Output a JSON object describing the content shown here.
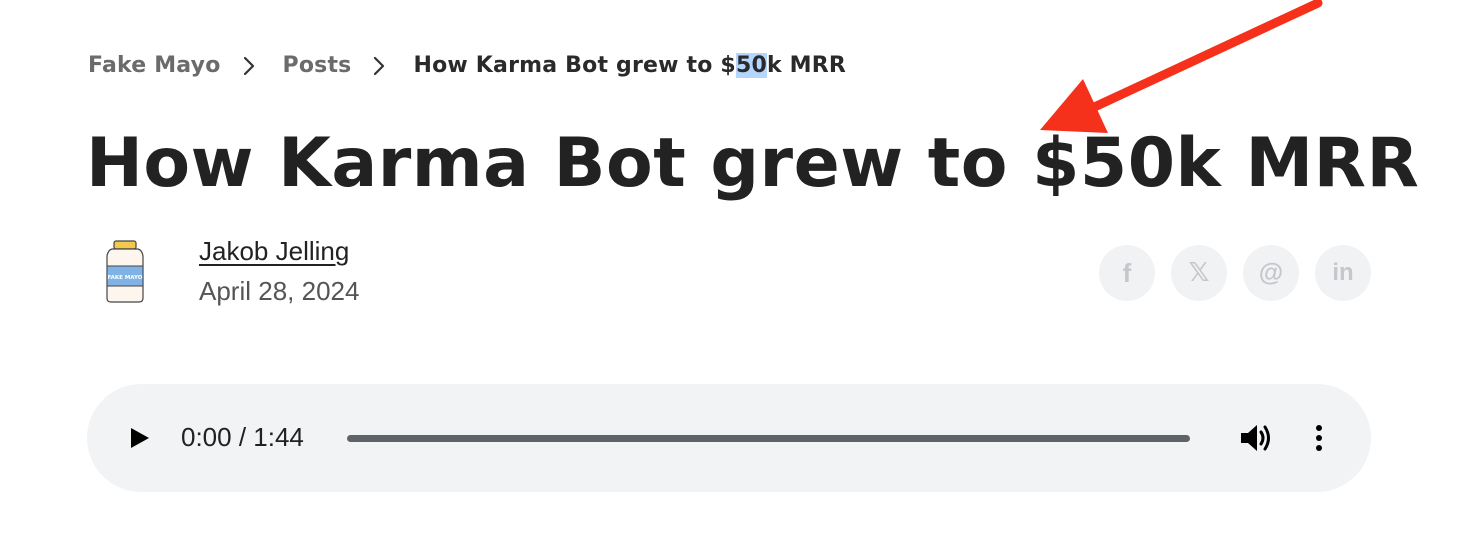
{
  "breadcrumb": {
    "items": [
      "Fake Mayo",
      "Posts"
    ],
    "current_prefix": "How Karma Bot grew to $",
    "current_highlight": "50",
    "current_suffix": "k MRR"
  },
  "article": {
    "title": "How Karma Bot grew to $50k MRR",
    "author": "Jakob Jelling",
    "date": "April 28, 2024",
    "avatar_label": "FAKE MAYO"
  },
  "share": {
    "facebook": "f",
    "x": "𝕏",
    "threads": "@",
    "linkedin": "in"
  },
  "audio": {
    "time": "0:00 / 1:44",
    "progress": 0
  },
  "annotation": {
    "arrow_color": "#f5311b",
    "target": "$50k in title"
  },
  "colors": {
    "highlight": "#b4d5fe",
    "player_bg": "#f1f3f4",
    "share_bg": "#f1f2f4"
  }
}
